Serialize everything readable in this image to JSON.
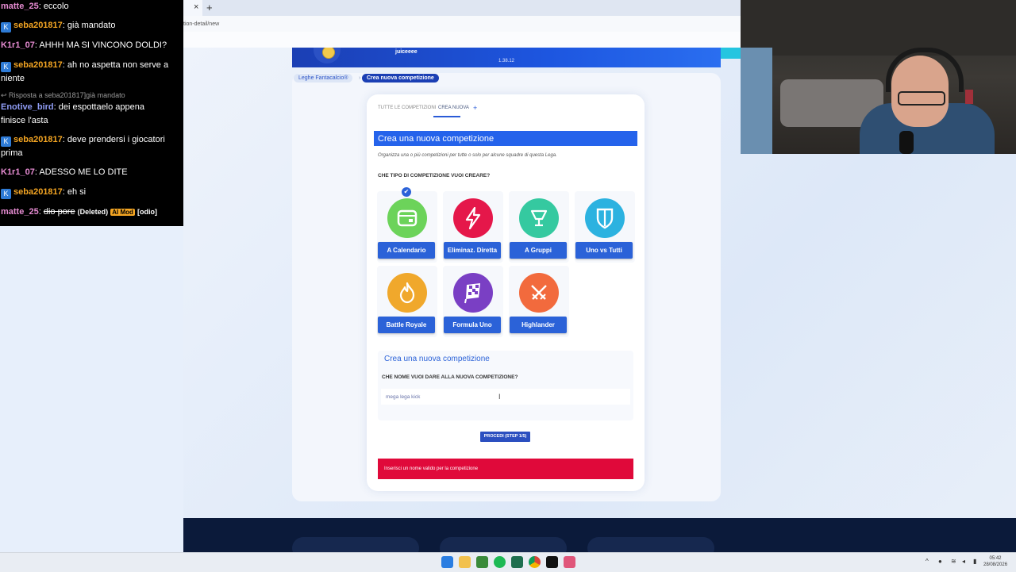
{
  "browser": {
    "url": "tion-detail/new"
  },
  "header": {
    "username": "juiceeee",
    "version": "1.38.12"
  },
  "breadcrumb": {
    "parent": "Leghe Fantacalcio®",
    "separator": "›",
    "current": "Crea nuova competizione"
  },
  "tabs": {
    "all": "TUTTE LE COMPETIZIONI",
    "new": "CREA NUOVA",
    "plus": "+"
  },
  "form": {
    "title": "Crea una nuova competizione",
    "intro": "Organizza una o più competizioni per tutte o solo per alcune squadre di questa Lega.",
    "question_type": "CHE TIPO DI COMPETIZIONE VUOI CREARE?",
    "selected_check": "✔",
    "types": [
      {
        "label": "A Calendario",
        "icon": "calendar-icon",
        "color": "#6cd35a"
      },
      {
        "label": "Eliminaz. Diretta",
        "icon": "lightning-icon",
        "color": "#e5174a"
      },
      {
        "label": "A Gruppi",
        "icon": "trophy-icon",
        "color": "#35c9a0"
      },
      {
        "label": "Uno vs Tutti",
        "icon": "shield-icon",
        "color": "#2cb2e0"
      },
      {
        "label": "Battle Royale",
        "icon": "flame-icon",
        "color": "#f0a82c"
      },
      {
        "label": "Formula Uno",
        "icon": "checkered-flag-icon",
        "color": "#7a3fc4"
      },
      {
        "label": "Highlander",
        "icon": "crossed-swords-icon",
        "color": "#f26a3d"
      }
    ],
    "name_box_title": "Crea una nuova competizione",
    "name_question": "CHE NOME VUOI DARE ALLA NUOVA COMPETIZIONE?",
    "name_value": "mega lega kick",
    "proceed": "PROCEDI (STEP 1/5)",
    "error": "Inserisci un nome valido per la competizione"
  },
  "chat": {
    "messages": [
      {
        "user": "matte_25",
        "user_color": "#e58bd1",
        "text": ": eccolo",
        "kick": false
      },
      {
        "user": "seba201817",
        "user_color": "#f5a623",
        "text": ": già mandato",
        "kick": true
      },
      {
        "user": "K1r1_07",
        "user_color": "#e58bd1",
        "text": ": AHHH MA SI VINCONO DOLDI?",
        "kick": false
      },
      {
        "user": "seba201817",
        "user_color": "#f5a623",
        "text": ": ah no aspetta non serve a",
        "text2": "niente",
        "kick": true
      },
      {
        "reply": "Risposta a seba201817]già mandato"
      },
      {
        "user": "Enotive_bird",
        "user_color": "#8f9cf5",
        "text": ": dei espottaelo appena",
        "text2": "finisce l'asta",
        "kick": false
      },
      {
        "user": "seba201817",
        "user_color": "#f5a623",
        "text": ": deve prendersi i giocatori",
        "text2": "prima",
        "kick": true
      },
      {
        "user": "K1r1_07",
        "user_color": "#e58bd1",
        "text": ": ADESSO ME LO DITE",
        "kick": false
      },
      {
        "user": "seba201817",
        "user_color": "#f5a623",
        "text": ": eh si",
        "kick": true
      },
      {
        "user": "matte_25",
        "user_color": "#e58bd1",
        "deleted": "dio pore",
        "deleted_tag": "(Deleted)",
        "badge": "AI Mod",
        "tail": "[odio]",
        "kick": false
      }
    ]
  },
  "taskbar": {
    "time": "05:42",
    "date": "28/08/2026"
  }
}
